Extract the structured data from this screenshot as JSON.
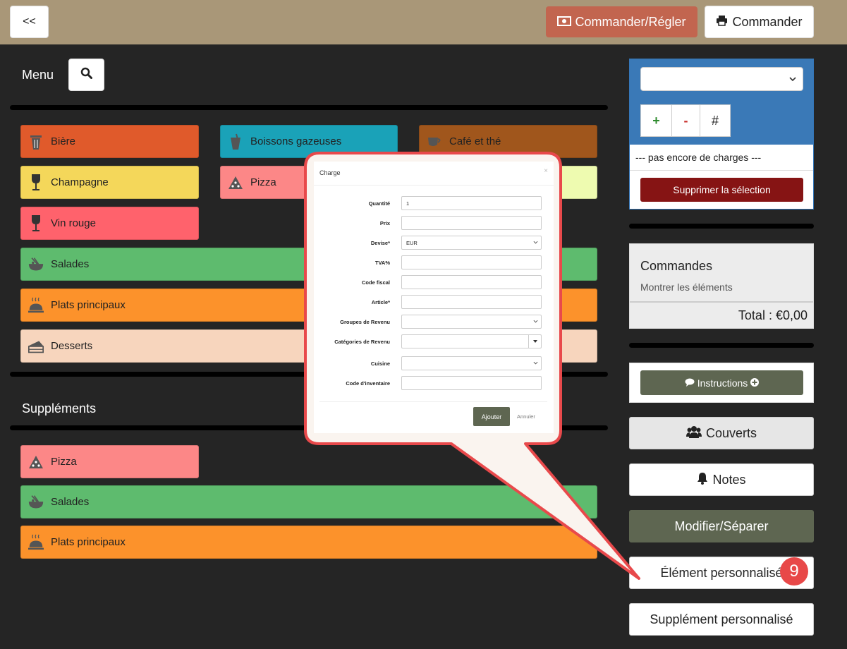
{
  "topbar": {
    "back_label": "<<",
    "order_pay_label": "Commander/Régler",
    "order_label": "Commander"
  },
  "menu": {
    "title": "Menu",
    "categories": [
      {
        "label": "Bière",
        "color": "#e05a2b",
        "icon": "trash-bin-icon"
      },
      {
        "label": "Boissons gazeuses",
        "color": "#1aa2b8",
        "icon": "soda-cup-icon"
      },
      {
        "label": "Café et thé",
        "color": "#a0561c",
        "icon": "coffee-cup-icon"
      },
      {
        "label": "Champagne",
        "color": "#f4d75a",
        "icon": "wine-glass-icon"
      },
      {
        "label": "Pizza",
        "color": "#fc8787",
        "icon": "pizza-icon"
      },
      {
        "label": "",
        "color": "#eefbb0",
        "icon": ""
      },
      {
        "label": "Vin rouge",
        "color": "#ff626c",
        "icon": "wine-glass-icon"
      },
      {
        "label": "Salades",
        "color": "#5ebb6e",
        "icon": "salad-bowl-icon"
      },
      {
        "label": "Plats principaux",
        "color": "#fc922b",
        "icon": "cloche-icon"
      },
      {
        "label": "Desserts",
        "color": "#f7d5bd",
        "icon": "cake-icon"
      }
    ]
  },
  "supplements": {
    "title": "Suppléments",
    "categories": [
      {
        "label": "Pizza",
        "color": "#fc8787",
        "icon": "pizza-icon"
      },
      {
        "label": "Salades",
        "color": "#5ebb6e",
        "icon": "salad-bowl-icon"
      },
      {
        "label": "Plats principaux",
        "color": "#fc922b",
        "icon": "cloche-icon"
      }
    ]
  },
  "charges": {
    "plus_label": "+",
    "minus_label": "-",
    "hash_label": "#",
    "empty_text": "--- pas encore de charges ---",
    "delete_label": "Supprimer la sélection"
  },
  "orders": {
    "title": "Commandes",
    "show_items": "Montrer les éléments",
    "total": "Total : €0,00"
  },
  "side_buttons": {
    "instructions": "Instructions",
    "covers": "Couverts",
    "notes": "Notes",
    "modify_split": "Modifier/Séparer",
    "custom_item": "Élément personnalisé",
    "custom_supplement": "Supplément personnalisé"
  },
  "callout": {
    "step_number": "9",
    "modal": {
      "title": "Charge",
      "close": "×",
      "fields": [
        {
          "label": "Quantité",
          "value": "1",
          "type": "text"
        },
        {
          "label": "Prix",
          "value": "",
          "type": "text"
        },
        {
          "label": "Devise*",
          "value": "EUR",
          "type": "select"
        },
        {
          "label": "TVA%",
          "value": "",
          "type": "text"
        },
        {
          "label": "Code fiscal",
          "value": "",
          "type": "text"
        },
        {
          "label": "Article*",
          "value": "",
          "type": "text"
        },
        {
          "label": "Groupes de Revenu",
          "value": "",
          "type": "select"
        },
        {
          "label": "Catégories de Revenu",
          "value": "",
          "type": "combo"
        },
        {
          "label": "Cuisine",
          "value": "",
          "type": "select"
        },
        {
          "label": "Code d'inventaire",
          "value": "",
          "type": "text"
        }
      ],
      "add_label": "Ajouter",
      "cancel_label": "Annuler"
    }
  }
}
